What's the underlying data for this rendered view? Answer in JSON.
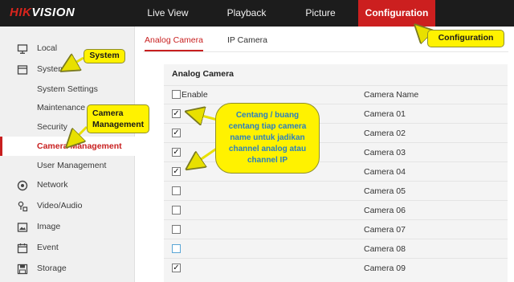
{
  "brand": {
    "logo_text": "HIKVISION",
    "accent_color": "#c81f1f"
  },
  "topnav": {
    "items": [
      {
        "label": "Live View"
      },
      {
        "label": "Playback"
      },
      {
        "label": "Picture"
      },
      {
        "label": "Configuration",
        "active": true
      }
    ]
  },
  "sidebar": {
    "items": [
      {
        "label": "Local",
        "icon": "monitor-icon"
      },
      {
        "label": "System",
        "icon": "system-icon"
      },
      {
        "label": "System Settings"
      },
      {
        "label": "Maintenance"
      },
      {
        "label": "Security"
      },
      {
        "label": "Camera Management",
        "active": true
      },
      {
        "label": "User Management"
      },
      {
        "label": "Network",
        "icon": "network-icon"
      },
      {
        "label": "Video/Audio",
        "icon": "video-audio-icon"
      },
      {
        "label": "Image",
        "icon": "image-icon"
      },
      {
        "label": "Event",
        "icon": "event-icon"
      },
      {
        "label": "Storage",
        "icon": "storage-icon"
      }
    ]
  },
  "tabs": [
    {
      "label": "Analog Camera",
      "active": true
    },
    {
      "label": "IP Camera"
    }
  ],
  "panel": {
    "title": "Analog Camera",
    "enable_label": "Enable",
    "name_header": "Camera Name",
    "rows": [
      {
        "name": "Camera 01",
        "checked": true
      },
      {
        "name": "Camera 02",
        "checked": true
      },
      {
        "name": "Camera 03",
        "checked": true
      },
      {
        "name": "Camera 04",
        "checked": true
      },
      {
        "name": "Camera 05",
        "checked": false
      },
      {
        "name": "Camera 06",
        "checked": false
      },
      {
        "name": "Camera 07",
        "checked": false
      },
      {
        "name": "Camera 08",
        "checked": false
      },
      {
        "name": "Camera 09",
        "checked": true
      }
    ]
  },
  "callouts": {
    "system": "System",
    "camera_mgmt": "Camera Management",
    "configuration": "Configuration",
    "note": "Centang / buang centang tiap camera name untuk jadikan channel analog atau channel IP"
  }
}
